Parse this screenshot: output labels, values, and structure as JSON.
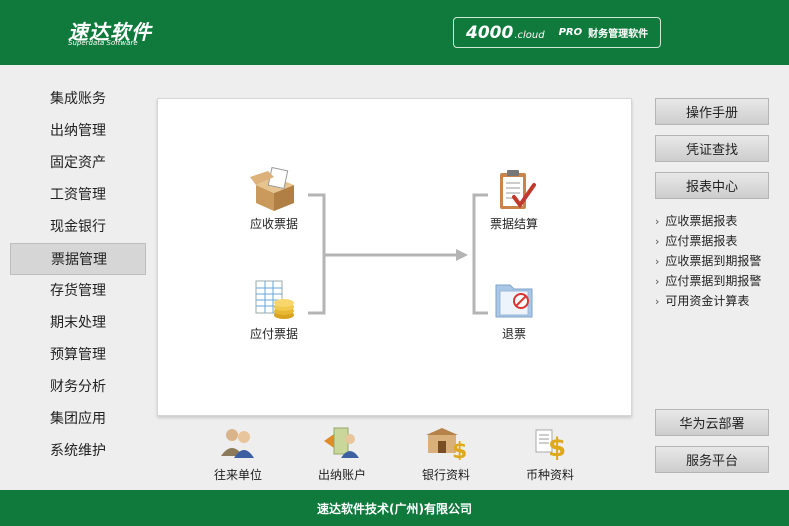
{
  "header": {
    "logo": "速达软件",
    "logo_sub": "Superdata Software",
    "product_4000": "4000",
    "product_cloud": ".cloud",
    "product_pro": "PRO",
    "product_name": "财务管理软件"
  },
  "sidebar": {
    "items": [
      {
        "label": "集成账务"
      },
      {
        "label": "出纳管理"
      },
      {
        "label": "固定资产"
      },
      {
        "label": "工资管理"
      },
      {
        "label": "现金银行"
      },
      {
        "label": "票据管理"
      },
      {
        "label": "存货管理"
      },
      {
        "label": "期末处理"
      },
      {
        "label": "预算管理"
      },
      {
        "label": "财务分析"
      },
      {
        "label": "集团应用"
      },
      {
        "label": "系统维护"
      }
    ],
    "active": "票据管理"
  },
  "flow": {
    "receivable": "应收票据",
    "payable": "应付票据",
    "settle": "票据结算",
    "refund": "退票"
  },
  "bottom": {
    "partners": "往来单位",
    "cashier_account": "出纳账户",
    "bank": "银行资料",
    "currency": "币种资料"
  },
  "right": {
    "manual": "操作手册",
    "voucher_search": "凭证查找",
    "report_center": "报表中心",
    "reports": [
      "应收票据报表",
      "应付票据报表",
      "应收票据到期报警",
      "应付票据到期报警",
      "可用资金计算表"
    ],
    "huawei": "华为云部署",
    "service": "服务平台"
  },
  "footer": {
    "company": "速达软件技术(广州)有限公司"
  },
  "colors": {
    "brand_green": "#0f7a3c",
    "background": "#eeeeee"
  }
}
